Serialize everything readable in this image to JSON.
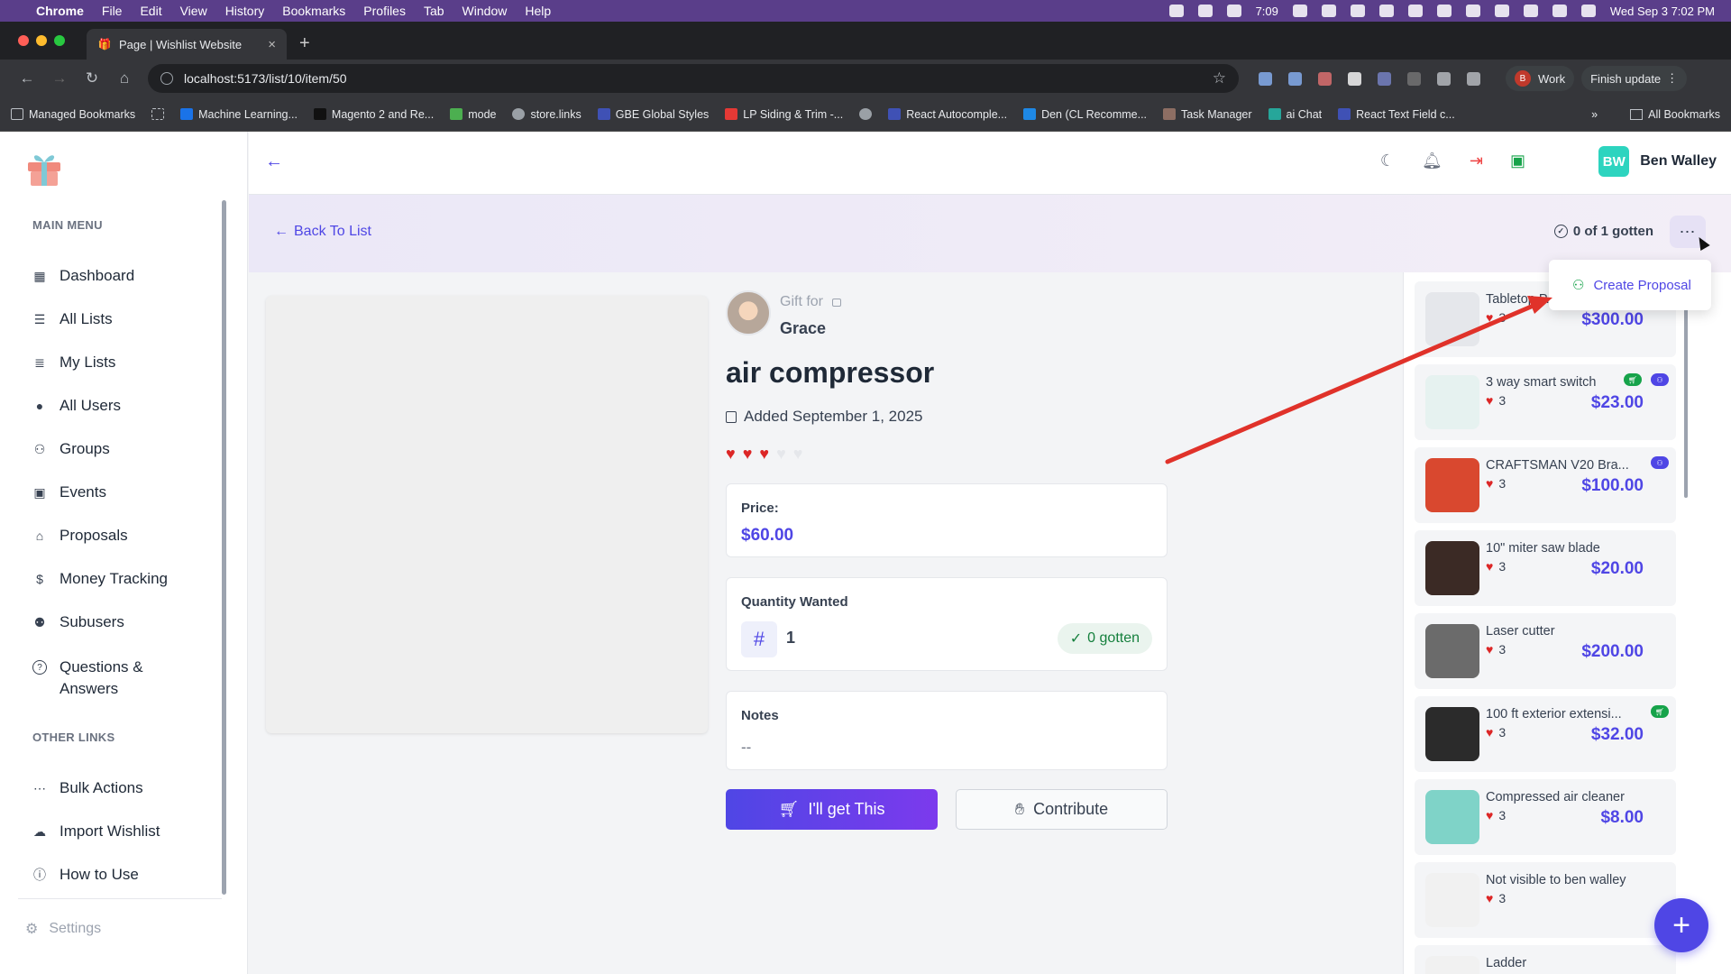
{
  "macos_menu": {
    "apple": "",
    "app": "Chrome",
    "items": [
      "File",
      "Edit",
      "View",
      "History",
      "Bookmarks",
      "Profiles",
      "Tab",
      "Window",
      "Help"
    ],
    "clock": "Wed Sep 3  7:02 PM",
    "timer": "7:09"
  },
  "browser": {
    "tab_title": "Page | Wishlist Website",
    "url": "localhost:5173/list/10/item/50",
    "profile": "Work",
    "profile_initial": "B",
    "finish_update": "Finish update",
    "bookmarks": [
      "Managed Bookmarks",
      "Machine Learning...",
      "Magento 2 and Re...",
      "mode",
      "store.links",
      "GBE Global Styles",
      "LP Siding & Trim -...",
      "React Autocomple...",
      "Den (CL Recomme...",
      "Task Manager",
      "ai Chat",
      "React Text Field c..."
    ],
    "all_bookmarks": "All Bookmarks"
  },
  "sidebar": {
    "main_menu": "MAIN MENU",
    "items": [
      {
        "label": "Dashboard",
        "icon": "grid-icon",
        "glyph": "▦"
      },
      {
        "label": "All Lists",
        "icon": "list-icon",
        "glyph": "☰"
      },
      {
        "label": "My Lists",
        "icon": "user-list-icon",
        "glyph": "≣"
      },
      {
        "label": "All Users",
        "icon": "user-icon",
        "glyph": "●"
      },
      {
        "label": "Groups",
        "icon": "users-icon",
        "glyph": "⚇"
      },
      {
        "label": "Events",
        "icon": "calendar-icon",
        "glyph": "▣"
      },
      {
        "label": "Proposals",
        "icon": "gift-icon",
        "glyph": "⌂"
      },
      {
        "label": "Money Tracking",
        "icon": "dollar-icon",
        "glyph": "$"
      },
      {
        "label": "Subusers",
        "icon": "subusers-icon",
        "glyph": "⚉"
      },
      {
        "label": "Questions &",
        "label2": "Answers",
        "icon": "question-icon",
        "glyph": "?"
      }
    ],
    "other_links": "OTHER LINKS",
    "other": [
      {
        "label": "Bulk Actions",
        "icon": "dots-icon",
        "glyph": "⋯"
      },
      {
        "label": "Import Wishlist",
        "icon": "cloud-icon",
        "glyph": "☁"
      },
      {
        "label": "How to Use",
        "icon": "info-icon",
        "glyph": "ⓘ"
      }
    ],
    "settings": "Settings"
  },
  "topbar": {
    "user": "Ben Walley",
    "initials": "BW"
  },
  "subheader": {
    "back": "Back To List",
    "gotten": "0 of 1 gotten"
  },
  "dropdown": {
    "create_proposal": "Create Proposal"
  },
  "item": {
    "gift_for": "Gift for",
    "recipient": "Grace",
    "title": "air compressor",
    "added": "Added September 1, 2025",
    "rating": 3,
    "rating_max": 5,
    "price_label": "Price:",
    "price": "$60.00",
    "quantity_label": "Quantity Wanted",
    "quantity": "1",
    "quantity_gotten": "0 gotten",
    "notes_label": "Notes",
    "notes": "--",
    "get_button": "I'll get This",
    "contribute_button": "Contribute"
  },
  "related": [
    {
      "name": "Tabletop P...",
      "rating": "3",
      "price": "$300.00",
      "color": "#e5e7eb"
    },
    {
      "name": "3 way smart switch",
      "rating": "3",
      "price": "$23.00",
      "color": "#e6f2f0"
    },
    {
      "name": "CRAFTSMAN V20 Bra...",
      "rating": "3",
      "price": "$100.00",
      "color": "#d9482f"
    },
    {
      "name": "10\" miter saw blade",
      "rating": "3",
      "price": "$20.00",
      "color": "#3b2a25"
    },
    {
      "name": "Laser cutter",
      "rating": "3",
      "price": "$200.00",
      "color": "#6b6b6b"
    },
    {
      "name": "100 ft exterior extensi...",
      "rating": "3",
      "price": "$32.00",
      "color": "#2b2b2b"
    },
    {
      "name": "Compressed air cleaner",
      "rating": "3",
      "price": "$8.00",
      "color": "#7fd3c8"
    },
    {
      "name": "Not visible to ben walley",
      "rating": "3",
      "price": "",
      "color": "#f1f1f1"
    },
    {
      "name": "Ladder",
      "rating": "",
      "price": "",
      "color": "#f1f1f1"
    }
  ],
  "colors": {
    "accent": "#4f46e5",
    "heart": "#dc2626",
    "green": "#15803d"
  }
}
